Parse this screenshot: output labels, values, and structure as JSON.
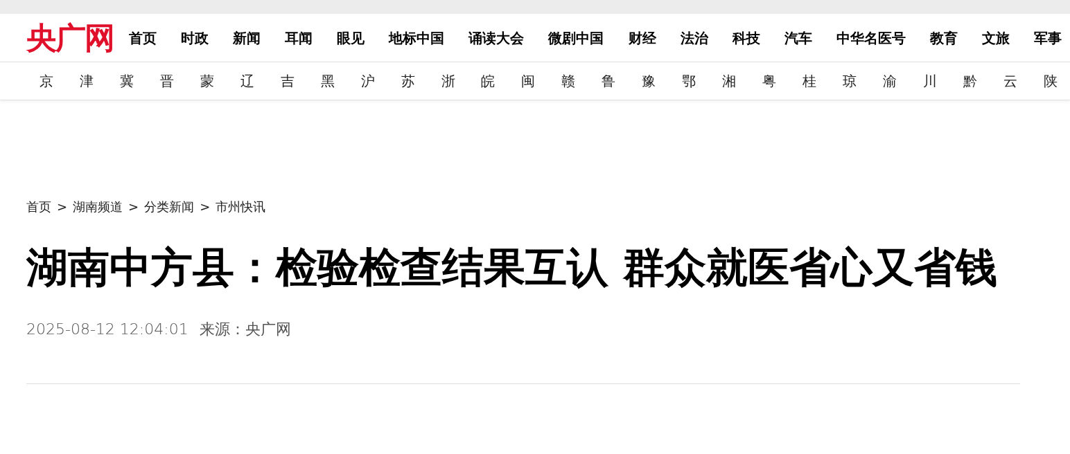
{
  "header": {
    "logo": "央广网",
    "nav": [
      "首页",
      "时政",
      "新闻",
      "耳闻",
      "眼见",
      "地标中国",
      "诵读大会",
      "微剧中国",
      "财经",
      "法治",
      "科技",
      "汽车",
      "中华名医号",
      "教育",
      "文旅",
      "军事"
    ]
  },
  "regions": [
    "京",
    "津",
    "冀",
    "晋",
    "蒙",
    "辽",
    "吉",
    "黑",
    "沪",
    "苏",
    "浙",
    "皖",
    "闽",
    "赣",
    "鲁",
    "豫",
    "鄂",
    "湘",
    "粤",
    "桂",
    "琼",
    "渝",
    "川",
    "黔",
    "云",
    "陕"
  ],
  "breadcrumb": [
    {
      "text": "首页"
    },
    {
      "separator": ">",
      "text": "湖南频道"
    },
    {
      "separator": ">",
      "text": "分类新闻"
    },
    {
      "separator": ">",
      "text": "市州快讯"
    }
  ],
  "article": {
    "title": "湖南中方县：检验检查结果互认 群众就医省心又省钱",
    "date": "2025-08-12 12:04:01",
    "source": "来源：央广网"
  }
}
